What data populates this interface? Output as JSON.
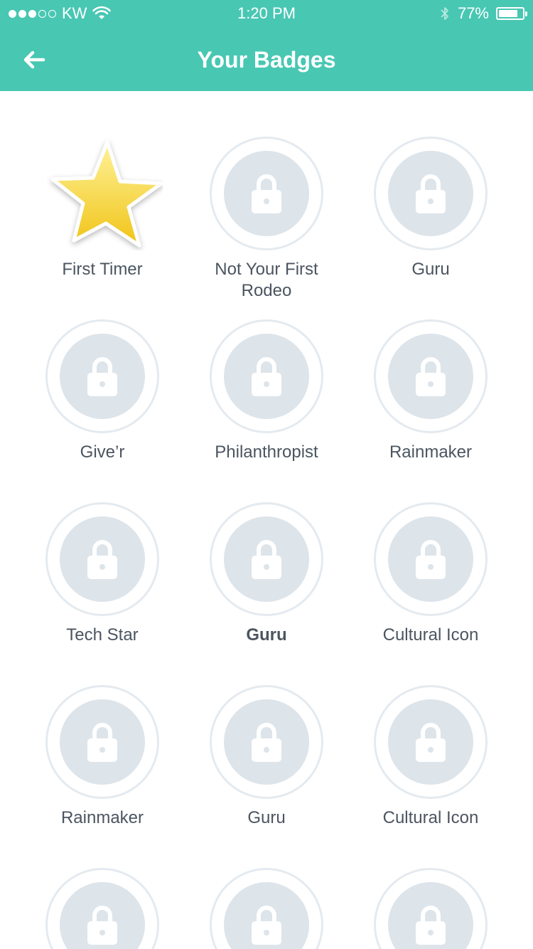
{
  "status_bar": {
    "carrier": "KW",
    "time": "1:20 PM",
    "battery": "77%",
    "battery_level": 0.77,
    "signal_bars_filled": 3,
    "signal_bars_total": 5
  },
  "header": {
    "title": "Your Badges",
    "background_color": "#48c7b3"
  },
  "badges": [
    {
      "label_line1": "First Timer",
      "label_line2": "",
      "unlocked": true
    },
    {
      "label_line1": "Not Your First",
      "label_line2": "Rodeo",
      "unlocked": false
    },
    {
      "label_line1": "Guru",
      "label_line2": "",
      "unlocked": false
    },
    {
      "label_line1": "Give’r",
      "label_line2": "",
      "unlocked": false
    },
    {
      "label_line1": "Philanthropist",
      "label_line2": "",
      "unlocked": false
    },
    {
      "label_line1": "Rainmaker",
      "label_line2": "",
      "unlocked": false
    },
    {
      "label_line1": "Tech Star",
      "label_line2": "",
      "unlocked": false
    },
    {
      "label_line1": "Guru",
      "label_line2": "",
      "unlocked": false,
      "bold": true
    },
    {
      "label_line1": "Cultural Icon",
      "label_line2": "",
      "unlocked": false
    },
    {
      "label_line1": "Rainmaker",
      "label_line2": "",
      "unlocked": false
    },
    {
      "label_line1": "Guru",
      "label_line2": "",
      "unlocked": false
    },
    {
      "label_line1": "Cultural Icon",
      "label_line2": "",
      "unlocked": false
    },
    {
      "label_line1": "",
      "label_line2": "",
      "unlocked": false
    },
    {
      "label_line1": "",
      "label_line2": "",
      "unlocked": false
    },
    {
      "label_line1": "",
      "label_line2": "",
      "unlocked": false
    }
  ]
}
